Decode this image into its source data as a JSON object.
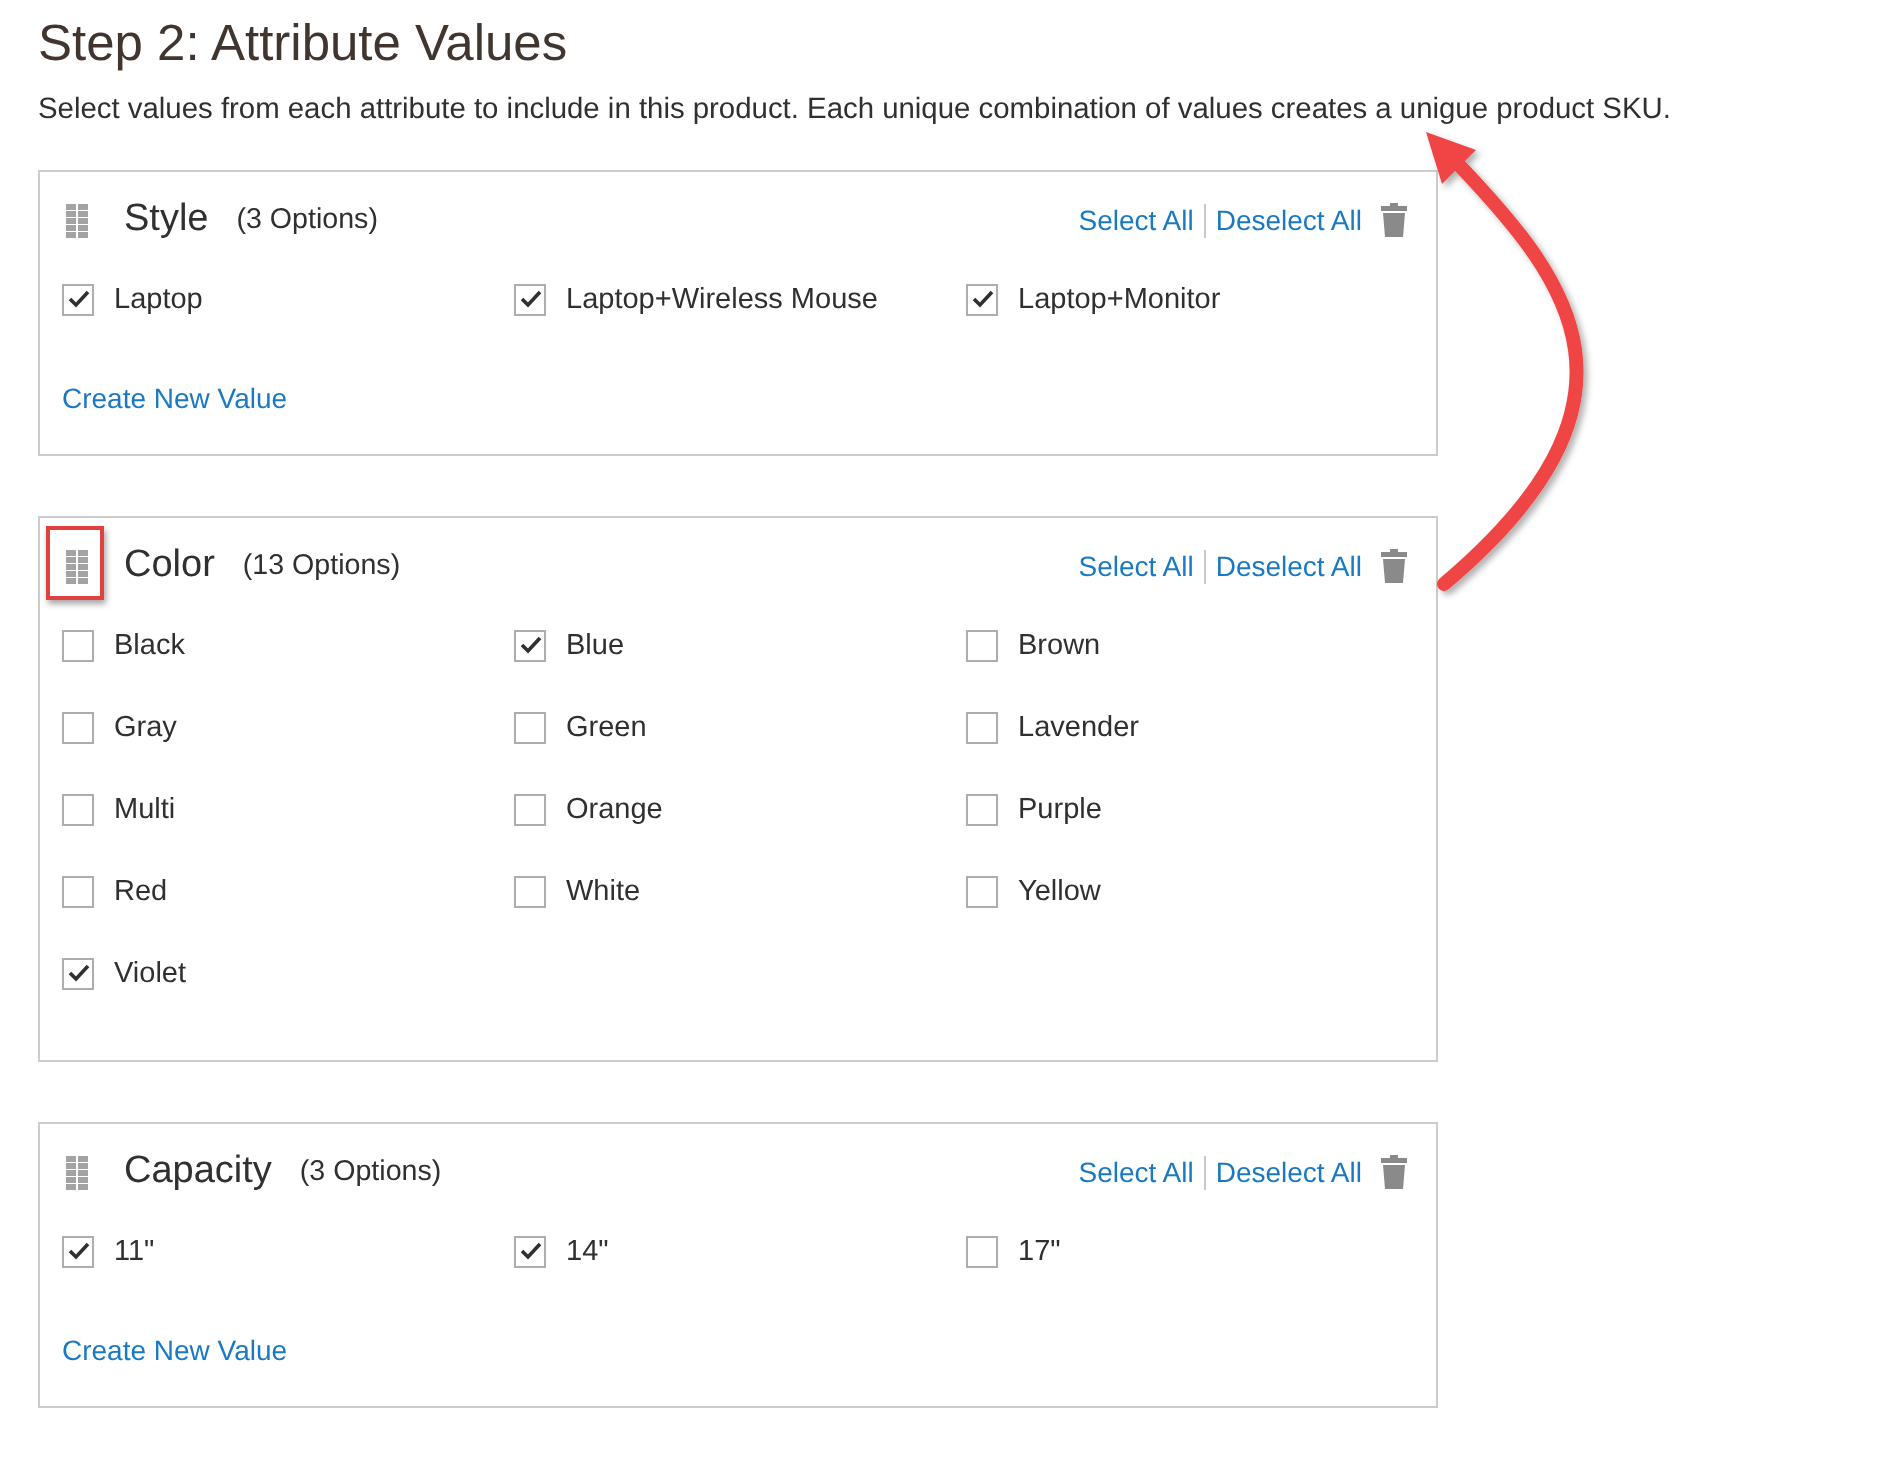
{
  "title": "Step 2: Attribute Values",
  "description": "Select values from each attribute to include in this product. Each unique combination of values creates a unigue product SKU.",
  "attributes": [
    {
      "name": "Style",
      "count": "(3 Options)",
      "highlighted": false,
      "select_all": "Select All",
      "deselect_all": "Deselect All",
      "options": [
        {
          "label": "Laptop",
          "checked": true
        },
        {
          "label": "Laptop+Wireless Mouse",
          "checked": true
        },
        {
          "label": "Laptop+Monitor",
          "checked": true
        }
      ],
      "create_link": "Create New Value"
    },
    {
      "name": "Color",
      "count": "(13 Options)",
      "highlighted": true,
      "select_all": "Select All",
      "deselect_all": "Deselect All",
      "options": [
        {
          "label": "Black",
          "checked": false
        },
        {
          "label": "Blue",
          "checked": true
        },
        {
          "label": "Brown",
          "checked": false
        },
        {
          "label": "Gray",
          "checked": false
        },
        {
          "label": "Green",
          "checked": false
        },
        {
          "label": "Lavender",
          "checked": false
        },
        {
          "label": "Multi",
          "checked": false
        },
        {
          "label": "Orange",
          "checked": false
        },
        {
          "label": "Purple",
          "checked": false
        },
        {
          "label": "Red",
          "checked": false
        },
        {
          "label": "White",
          "checked": false
        },
        {
          "label": "Yellow",
          "checked": false
        },
        {
          "label": "Violet",
          "checked": true
        }
      ]
    },
    {
      "name": "Capacity",
      "count": "(3 Options)",
      "highlighted": false,
      "select_all": "Select All",
      "deselect_all": "Deselect All",
      "options": [
        {
          "label": "11\"",
          "checked": true
        },
        {
          "label": "14\"",
          "checked": true
        },
        {
          "label": "17\"",
          "checked": false
        }
      ],
      "create_link": "Create New Value"
    }
  ]
}
